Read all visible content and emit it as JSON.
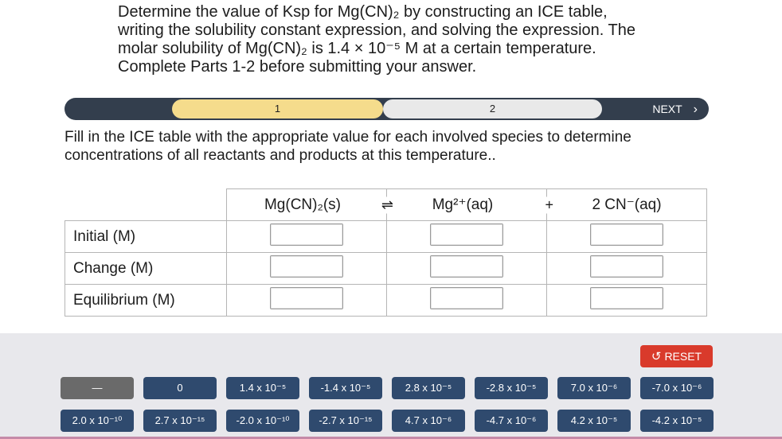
{
  "question": {
    "lines": [
      "Determine the value of Ksp for Mg(CN)₂ by constructing an ICE table,",
      "writing the solubility constant expression, and solving the expression. The",
      "molar solubility of Mg(CN)₂ is 1.4 × 10⁻⁵ M at a certain temperature.",
      "Complete Parts 1-2 before submitting your answer."
    ]
  },
  "stepper": {
    "step1": "1",
    "step2": "2",
    "next_label": "NEXT",
    "next_icon": "›"
  },
  "instruction": {
    "lines": [
      "Fill in the ICE table with the appropriate value for each involved species to determine",
      "concentrations of all reactants and products at this temperature.."
    ]
  },
  "ice_table": {
    "headers": [
      "Mg(CN)₂(s)",
      "Mg²⁺(aq)",
      "2 CN⁻(aq)"
    ],
    "arrow": "⇌",
    "plus": "+",
    "rows": [
      "Initial (M)",
      "Change (M)",
      "Equilibrium (M)"
    ]
  },
  "reset_label": "RESET",
  "reset_icon": "↺",
  "tiles": {
    "row1": [
      "—",
      "0",
      "1.4 x 10⁻⁵",
      "-1.4 x 10⁻⁵",
      "2.8 x 10⁻⁵",
      "-2.8 x 10⁻⁵",
      "7.0 x 10⁻⁶",
      "-7.0 x 10⁻⁶"
    ],
    "row2": [
      "2.0 x 10⁻¹⁰",
      "2.7 x 10⁻¹⁵",
      "-2.0 x 10⁻¹⁰",
      "-2.7 x 10⁻¹⁵",
      "4.7 x 10⁻⁶",
      "-4.7 x 10⁻⁶",
      "4.2 x 10⁻⁵",
      "-4.2 x 10⁻⁵"
    ]
  }
}
